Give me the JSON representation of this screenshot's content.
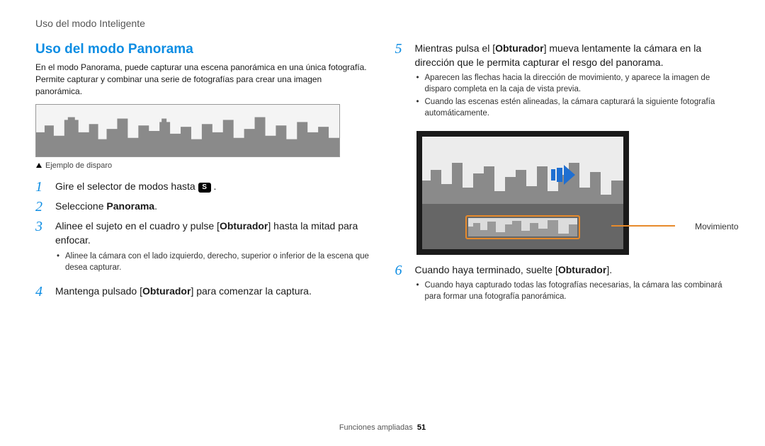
{
  "header": "Uso del modo Inteligente",
  "title": "Uso del modo Panorama",
  "intro": "En el modo Panorama, puede capturar una escena panorámica en una única fotografía. Permite capturar y combinar una serie de fotografías para crear una imagen panorámica.",
  "example_caption": "Ejemplo de disparo",
  "icons": {
    "mode_dial": "S"
  },
  "steps": {
    "s1_a": "Gire el selector de modos hasta ",
    "s1_b": ".",
    "s2_a": "Seleccione ",
    "s2_b": "Panorama",
    "s2_c": ".",
    "s3_a": "Alinee el sujeto en el cuadro y pulse [",
    "s3_b": "Obturador",
    "s3_c": "] hasta la mitad para enfocar.",
    "s3_sub1": "Alinee la cámara con el lado izquierdo, derecho, superior o inferior de la escena que desea capturar.",
    "s4_a": "Mantenga pulsado [",
    "s4_b": "Obturador",
    "s4_c": "] para comenzar la captura.",
    "s5_a": "Mientras pulsa el [",
    "s5_b": "Obturador",
    "s5_c": "] mueva lentamente la cámara en la dirección que le permita capturar el resgo del panorama.",
    "s5_sub1": "Aparecen las flechas hacia la dirección de movimiento, y aparece la imagen de disparo completa en la caja de vista previa.",
    "s5_sub2": "Cuando las escenas estén alineadas, la cámara capturará la siguiente fotografía automáticamente.",
    "s6_a": "Cuando haya terminado, suelte [",
    "s6_b": "Obturador",
    "s6_c": "].",
    "s6_sub1": "Cuando haya capturado todas las fotografías necesarias, la cámara las combinará para formar una fotografía panorámica."
  },
  "movement_label": "Movimiento",
  "footer_text": "Funciones ampliadas",
  "page_number": "51"
}
